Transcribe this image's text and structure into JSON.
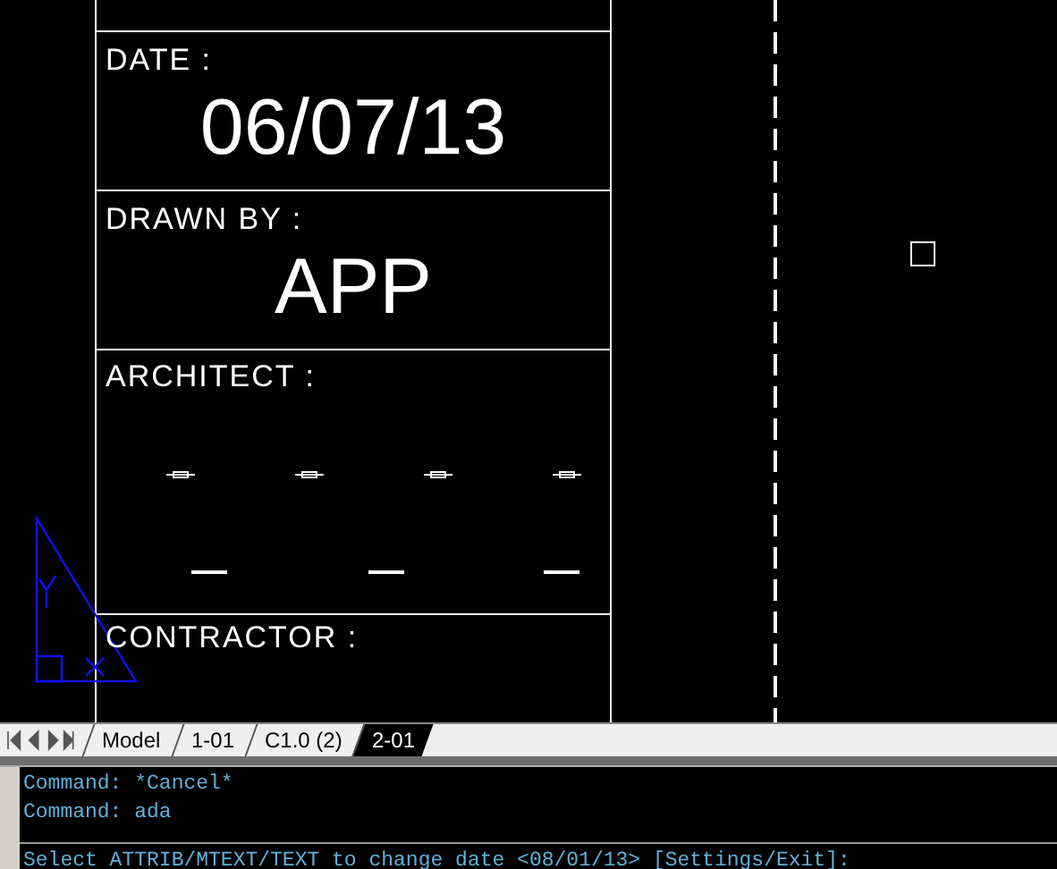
{
  "drawing": {
    "fields": [
      {
        "label": "DATE :",
        "value": "06/07/13"
      },
      {
        "label": "DRAWN BY :",
        "value": "APP"
      },
      {
        "label": "ARCHITECT :"
      },
      {
        "label": "CONTRACTOR :"
      }
    ]
  },
  "layout_tabs": [
    {
      "label": "Model",
      "selected": false
    },
    {
      "label": "1-01",
      "selected": false
    },
    {
      "label": "C1.0 (2)",
      "selected": false
    },
    {
      "label": "2-01",
      "selected": true
    }
  ],
  "command_history": [
    "Command: *Cancel*",
    "Command: ada"
  ],
  "command_prompt": "Select ATTRIB/MTEXT/TEXT to change date <08/01/13> [Settings/Exit]:"
}
